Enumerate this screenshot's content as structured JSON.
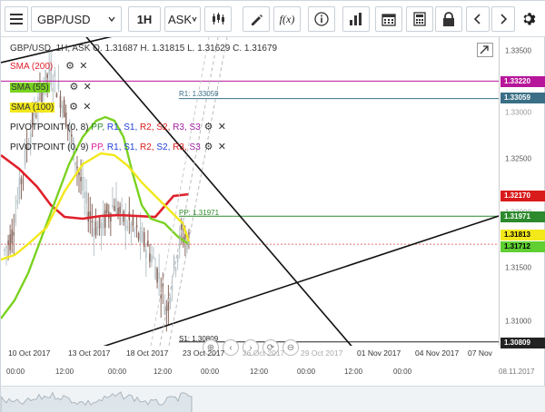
{
  "toolbar": {
    "symbol": "GBP/USD",
    "timeframe": "1H",
    "price_side": "ASK"
  },
  "header": {
    "ohlc": "GBP/USD, 1H, ASK   O. 1.31687 H. 1.31815 L. 1.31629 C. 1.31679"
  },
  "legend": [
    {
      "name": "SMA (200)",
      "color": "#e0202a"
    },
    {
      "name": "SMA (55)",
      "color": "#7ad220"
    },
    {
      "name": "SMA (100)",
      "color": "#f2e81a"
    },
    {
      "name": "PIVOTPOINT (0, 8)",
      "parts": [
        "PP,",
        "R1,",
        "S1,",
        "R2,",
        "S2,",
        "R3,",
        "S3"
      ]
    },
    {
      "name": "PIVOTPOINT (0, 9)",
      "parts": [
        "PP,",
        "R1,",
        "S1,",
        "R2,",
        "S2,",
        "R3,",
        "S3"
      ]
    }
  ],
  "yaxis": {
    "ticks": [
      "1.33500",
      "1.32500",
      "1.31500",
      "1.31000"
    ],
    "badges": [
      {
        "label": "1.33220",
        "bg": "#b7169a",
        "fg": "#ffffff"
      },
      {
        "label": "1.33059",
        "bg": "#3a6f86",
        "fg": "#ffffff"
      },
      {
        "label": "1.32170",
        "bg": "#d91b1b",
        "fg": "#ffffff"
      },
      {
        "label": "1.31971",
        "bg": "#2d8a2d",
        "fg": "#ffffff"
      },
      {
        "label": "1.31813",
        "bg": "#f2e81a",
        "fg": "#000000"
      },
      {
        "label": "1.31712",
        "bg": "#5fcf32",
        "fg": "#000000"
      },
      {
        "label": "1.30809",
        "bg": "#222222",
        "fg": "#ffffff"
      }
    ],
    "extra_ticks": [
      "1.33000",
      "1.32000"
    ]
  },
  "level_labels": {
    "r1": "R1: 1.33059",
    "pp": "PP: 1.31971",
    "s1": "S1: 1.30809"
  },
  "dates": [
    "10 Oct 2017",
    "13 Oct 2017",
    "18 Oct 2017",
    "23 Oct 2017",
    "26 Oct 2017",
    "29 Oct 2017",
    "01 Nov 2017",
    "04 Nov 2017",
    "07 Nov"
  ],
  "times": [
    "00:00",
    "12:00",
    "00:00",
    "12:00",
    "00:00",
    "12:00",
    "00:00",
    "12:00",
    "00:00"
  ],
  "last_date": "08.11.2017",
  "colors": {
    "sma200": "#e0202a",
    "sma55": "#7ad220",
    "sma100": "#f2e81a",
    "resistance": "#b7169a",
    "r1": "#3a6f86",
    "pp": "#2d8a2d",
    "candle_up": "#b8c4c8",
    "candle_down": "#8a6a60"
  }
}
